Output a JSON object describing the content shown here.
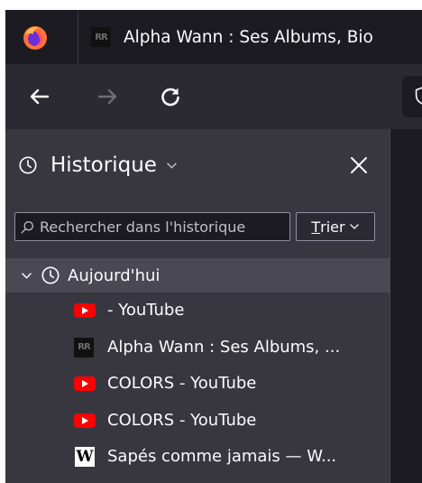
{
  "tabbar": {
    "active_tab_title": "Alpha Wann : Ses Albums, Bio",
    "active_tab_favicon": "rapreference-rr-icon",
    "browser_icon": "firefox-icon"
  },
  "navbar": {
    "back_icon": "back-arrow-icon",
    "forward_icon": "forward-arrow-icon",
    "reload_icon": "reload-icon",
    "shield_icon": "tracking-shield-icon"
  },
  "sidebar": {
    "title": "Historique",
    "title_icon": "clock-icon",
    "close_icon": "close-icon",
    "search_placeholder": "Rechercher dans l'historique",
    "sort_label_underlined": "T",
    "sort_label_rest": "rier",
    "group": {
      "label": "Aujourd'hui",
      "expanded": true
    },
    "items": [
      {
        "label": "- YouTube",
        "icon": "youtube-icon"
      },
      {
        "label": "Alpha Wann : Ses Albums, ...",
        "icon": "rapreference-rr-icon"
      },
      {
        "label": "COLORS - YouTube",
        "icon": "youtube-icon"
      },
      {
        "label": "COLORS - YouTube",
        "icon": "youtube-icon"
      },
      {
        "label": "Sapés comme jamais — W...",
        "icon": "wikipedia-icon"
      }
    ]
  },
  "colors": {
    "tabbar_bg": "#1c1b22",
    "navbar_bg": "#2b2a33",
    "sidebar_bg": "#38373f",
    "selected_row_bg": "#4a4953",
    "text": "#fbfbfe",
    "youtube_red": "#ff0000"
  }
}
